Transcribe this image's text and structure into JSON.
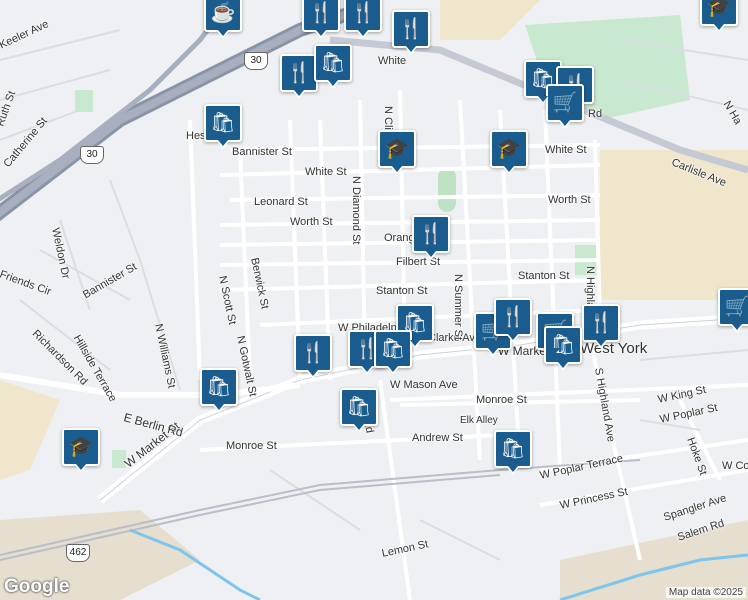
{
  "map": {
    "streets": [
      "Bannister St",
      "White St",
      "Leonard St",
      "Worth St",
      "Orange St",
      "Filbert St",
      "Stanton St",
      "W Philadelphia St",
      "Clarke Ave",
      "W Market St",
      "W Mason Ave",
      "Monroe St",
      "Elk Alley",
      "Andrew St",
      "N Diamond St",
      "N Clinton St",
      "N Summer St",
      "N Highland Ave",
      "S Highland Ave",
      "Berwick St",
      "N Scott St",
      "N Gotwalt St",
      "N Williams St",
      "Weldon Dr",
      "Hillside Terrace",
      "Richardson Rd",
      "Friends Cir",
      "Catherine St",
      "Ruth St",
      "Keeler Ave",
      "E Berlin Rd",
      "Hess",
      "White",
      "Carlisle Ave",
      "W King St",
      "W Poplar St",
      "Hoke St",
      "W Poplar Terrace",
      "W Princess St",
      "Spangler Ave",
      "Salem Rd",
      "Lemon St",
      "W Co",
      "N Ha",
      "Rd",
      "W Philadelphia St",
      "Hill Rd",
      "Worth St",
      "Bannister St",
      "White St",
      "Stanton St",
      "Monroe St"
    ],
    "highway_shields": [
      "30",
      "30",
      "462"
    ],
    "town_label": "West York",
    "attribution": "Map data ©2025",
    "logo": "Google",
    "poi_icons": [
      "cafe-icon",
      "restaurant-icon",
      "restaurant-icon",
      "restaurant-icon",
      "restaurant-icon",
      "restaurant-icon",
      "restaurant-icon",
      "shopping-bag-icon",
      "restaurant-icon",
      "shopping-bag-icon",
      "school-icon",
      "school-icon",
      "shopping-bag-icon",
      "restaurant-icon",
      "shopping-cart-icon",
      "school-icon",
      "restaurant-icon",
      "shopping-bag-icon",
      "shopping-bag-icon",
      "restaurant-icon",
      "shopping-bag-icon",
      "shopping-cart-icon",
      "restaurant-icon",
      "shopping-cart-icon",
      "shopping-cart-icon",
      "shopping-cart-icon",
      "restaurant-icon",
      "shopping-bag-icon",
      "shopping-bag-icon",
      "shopping-bag-icon",
      "school-icon",
      "shopping-cart-icon",
      "school-icon"
    ]
  }
}
